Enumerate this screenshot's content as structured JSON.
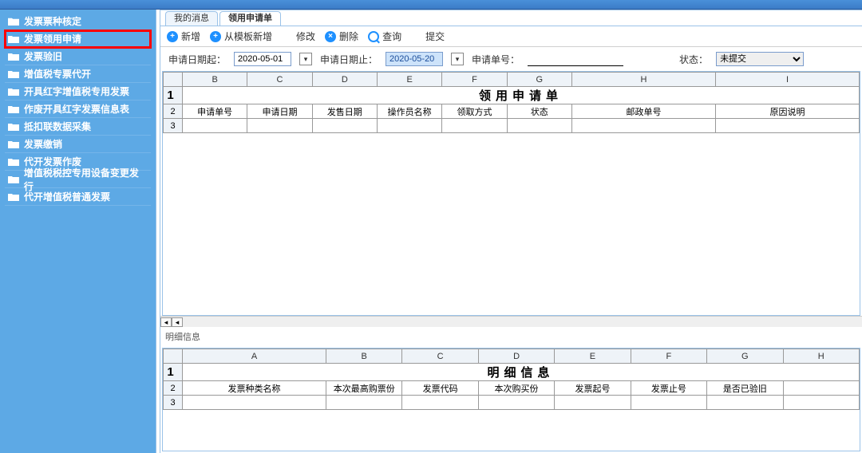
{
  "sidebar": {
    "items": [
      {
        "label": "发票票种核定"
      },
      {
        "label": "发票领用申请"
      },
      {
        "label": "发票验旧"
      },
      {
        "label": "增值税专票代开"
      },
      {
        "label": "开具红字增值税专用发票"
      },
      {
        "label": "作废开具红字发票信息表"
      },
      {
        "label": "抵扣联数据采集"
      },
      {
        "label": "发票缴销"
      },
      {
        "label": "代开发票作废"
      },
      {
        "label": "增值税税控专用设备变更发行"
      },
      {
        "label": "代开增值税普通发票"
      }
    ]
  },
  "tabs": [
    {
      "label": "我的消息"
    },
    {
      "label": "领用申请单"
    }
  ],
  "toolbar": {
    "new_label": "新增",
    "new_from_template_label": "从模板新增",
    "edit_label": "修改",
    "delete_label": "删除",
    "search_label": "查询",
    "submit_label": "提交"
  },
  "filter": {
    "date_from_label": "申请日期起：",
    "date_from_value": "2020-05-01",
    "date_to_label": "申请日期止：",
    "date_to_value": "2020-05-20",
    "number_label": "申请单号：",
    "number_value": "",
    "status_label": "状态：",
    "status_value": "未提交"
  },
  "chart_data": {
    "main_grid": {
      "type": "table",
      "title": "领用申请单",
      "col_letters": [
        "B",
        "C",
        "D",
        "E",
        "F",
        "G",
        "H",
        "I"
      ],
      "headers": [
        "申请单号",
        "申请日期",
        "发售日期",
        "操作员名称",
        "领取方式",
        "状态",
        "邮政单号",
        "原因说明"
      ],
      "rows": []
    },
    "detail_grid": {
      "type": "table",
      "section_label": "明细信息",
      "title": "明细信息",
      "col_letters": [
        "A",
        "B",
        "C",
        "D",
        "E",
        "F",
        "G",
        "H"
      ],
      "headers": [
        "发票种类名称",
        "本次最高购票份",
        "发票代码",
        "本次购买份",
        "发票起号",
        "发票止号",
        "是否已验旧"
      ],
      "rows": []
    }
  }
}
